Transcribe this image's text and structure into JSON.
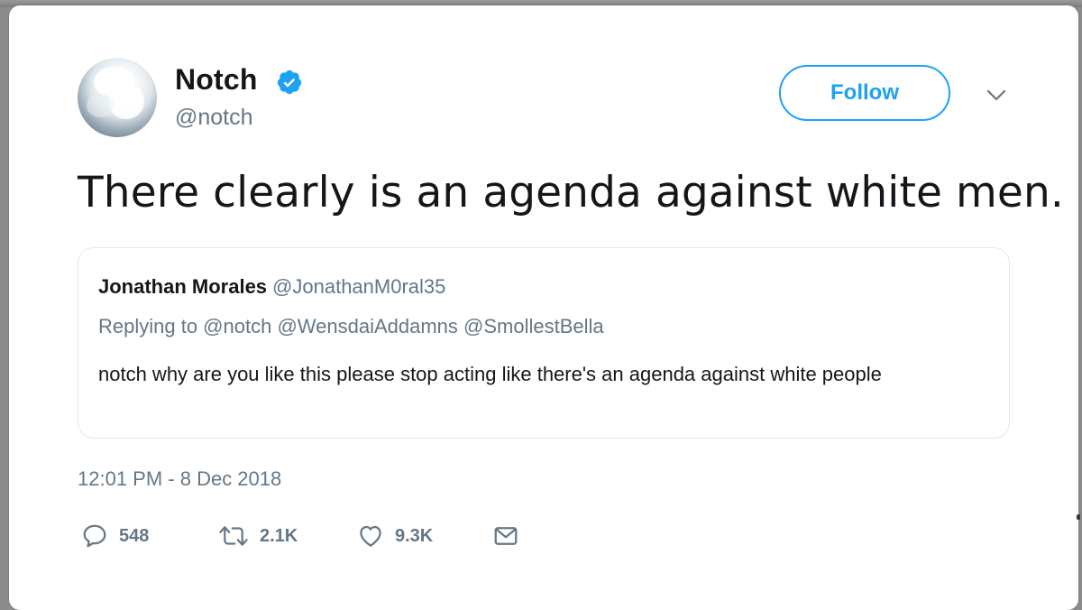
{
  "author": {
    "name": "Notch",
    "handle": "@notch",
    "verified": true
  },
  "follow_button": {
    "label": "Follow"
  },
  "tweet": {
    "text": "There clearly is an agenda against white men.",
    "timestamp": "12:01 PM - 8 Dec 2018"
  },
  "quoted_tweet": {
    "name": "Jonathan Morales",
    "handle": "@JonathanM0ral35",
    "replying_to": "Replying to @notch @WensdaiAddamns @SmollestBella",
    "text": "notch why are you like this please stop acting like there's an agenda against white people"
  },
  "actions": {
    "replies": "548",
    "retweets": "2.1K",
    "likes": "9.3K"
  },
  "icons": {
    "verified": "verified-badge-icon",
    "chevron": "chevron-down-icon",
    "reply": "reply-icon",
    "retweet": "retweet-icon",
    "like": "heart-icon",
    "message": "envelope-icon"
  },
  "colors": {
    "accent": "#1da1f2",
    "text": "#14171a",
    "muted": "#657786",
    "border": "#e1e8ed"
  }
}
